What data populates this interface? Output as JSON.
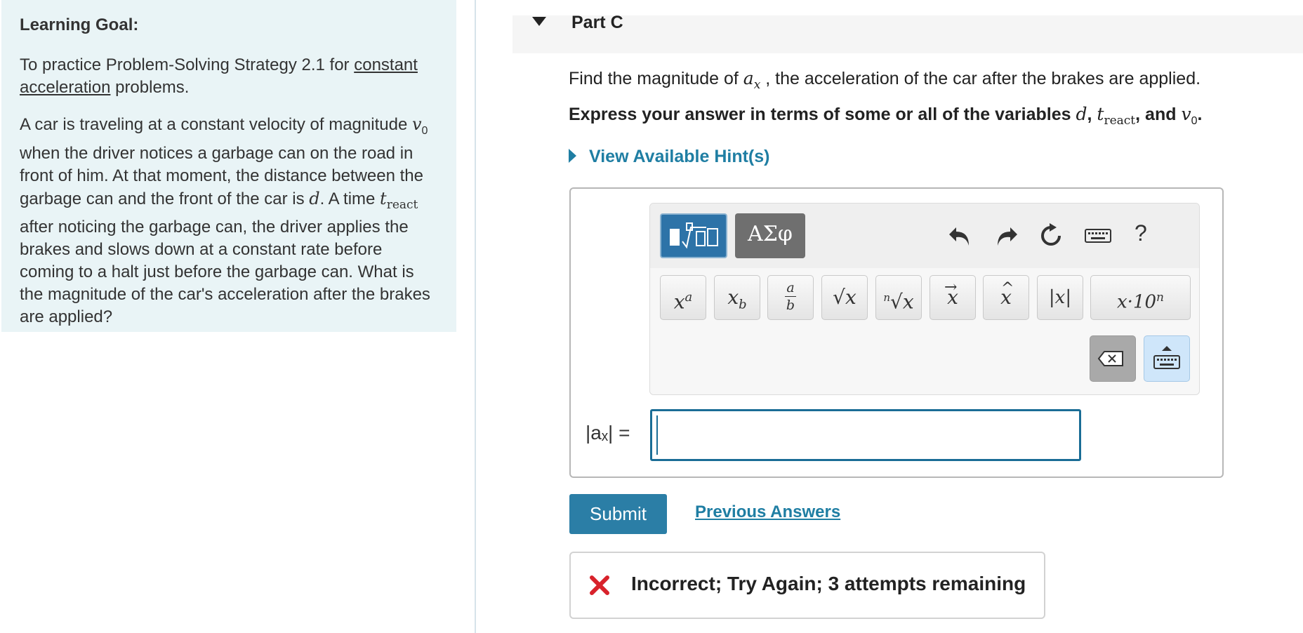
{
  "learning_goal": {
    "heading": "Learning Goal:",
    "intro_before_link": "To practice Problem-Solving Strategy 2.1 for",
    "intro_link": "constant acceleration",
    "intro_after_link": "problems.",
    "problem": {
      "t1": "A car is traveling at a constant velocity of magnitude",
      "v0": "v",
      "v0_sub": "0",
      "t2": "when the driver notices a garbage can on the road in front of him. At that moment, the distance between the garbage can and the front of the car is",
      "d": "d",
      "t3": ". A time",
      "t_var": "t",
      "t_sub": "react",
      "t4": "after noticing the garbage can, the driver applies the brakes and slows down at a constant rate before coming to a halt just before the garbage can. What is the magnitude of the car's acceleration after the brakes are applied?"
    }
  },
  "part": {
    "title": "Part C"
  },
  "question": {
    "before_var": "Find the magnitude of",
    "var": "a",
    "var_sub": "x",
    "after_var": ", the acceleration of the car after the brakes are applied."
  },
  "express": {
    "text": "Express your answer in terms of some or all of the variables",
    "v1": "d",
    "comma": ",",
    "v2": "t",
    "v2_sub": "react",
    "and": ", and",
    "v3": "v",
    "v3_sub": "0",
    "end": "."
  },
  "hint": {
    "label": "View Available Hint(s)"
  },
  "toolbar": {
    "greek_label": "ΑΣφ",
    "help_label": "?",
    "keys": [
      "xᵃ",
      "x_b",
      "a/b",
      "√x",
      "ⁿ√x",
      "x⃗",
      "x̂",
      "|x|",
      "x·10ⁿ"
    ]
  },
  "answer": {
    "label": "|aₓ| =",
    "value": ""
  },
  "actions": {
    "submit_label": "Submit",
    "previous_answers_label": "Previous Answers"
  },
  "feedback": {
    "text": "Incorrect; Try Again; 3 attempts remaining",
    "icon": "x-mark-icon",
    "color": "#d8222b"
  },
  "colors": {
    "accent": "#1f7ea3",
    "button": "#2b7ea6",
    "left_panel_bg": "#e9f4f6"
  }
}
